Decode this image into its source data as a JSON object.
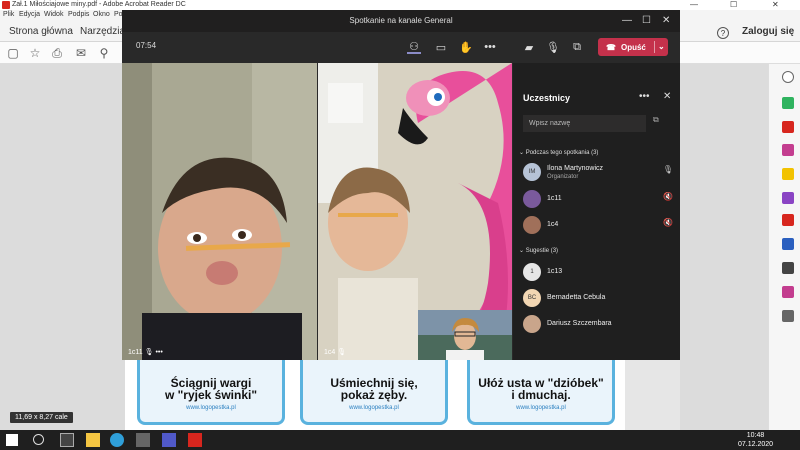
{
  "acrobat": {
    "title": "Zał.1 Miłościajowe miny.pdf - Adobe Acrobat Reader DC",
    "menu": [
      "Plik",
      "Edycja",
      "Widok",
      "Podpis",
      "Okno",
      "Po"
    ],
    "tabs": [
      "Strona główna",
      "Narzędzia"
    ],
    "help": "?",
    "login": "Zaloguj się",
    "page_size": "11,69 x 8,27 cale",
    "cards": [
      {
        "line1": "Ściągnij wargi",
        "line2": "w \"ryjek świnki\"",
        "url": "www.logopestka.pl"
      },
      {
        "line1": "Uśmiechnij się,",
        "line2": "pokaż zęby.",
        "url": "www.logopestka.pl"
      },
      {
        "line1": "Ułóż usta w \"dzióbek\"",
        "line2": "i dmuchaj.",
        "url": "www.logopestka.pl"
      }
    ]
  },
  "teams": {
    "window_title": "Spotkanie na kanale General",
    "timer": "07:54",
    "leave_label": "Opuść",
    "tiles": [
      {
        "label": "1c11"
      },
      {
        "label": "1c4"
      }
    ],
    "panel": {
      "title": "Uczestnicy",
      "search_placeholder": "Wpisz nazwę",
      "section_in_meeting": "Podczas tego spotkania (3)",
      "section_suggestions": "Sugestie (3)",
      "participants": [
        {
          "initials": "IM",
          "name": "Ilona Martynowicz",
          "role": "Organizator"
        },
        {
          "initials": "",
          "name": "1c11",
          "role": ""
        },
        {
          "initials": "",
          "name": "1c4",
          "role": ""
        }
      ],
      "suggestions": [
        {
          "initials": "1",
          "name": "1c13"
        },
        {
          "initials": "BC",
          "name": "Bernadetta Cebula"
        },
        {
          "initials": "",
          "name": "Dariusz Szczembara"
        }
      ]
    }
  },
  "taskbar": {
    "time": "10:48",
    "date": "07.12.2020"
  }
}
